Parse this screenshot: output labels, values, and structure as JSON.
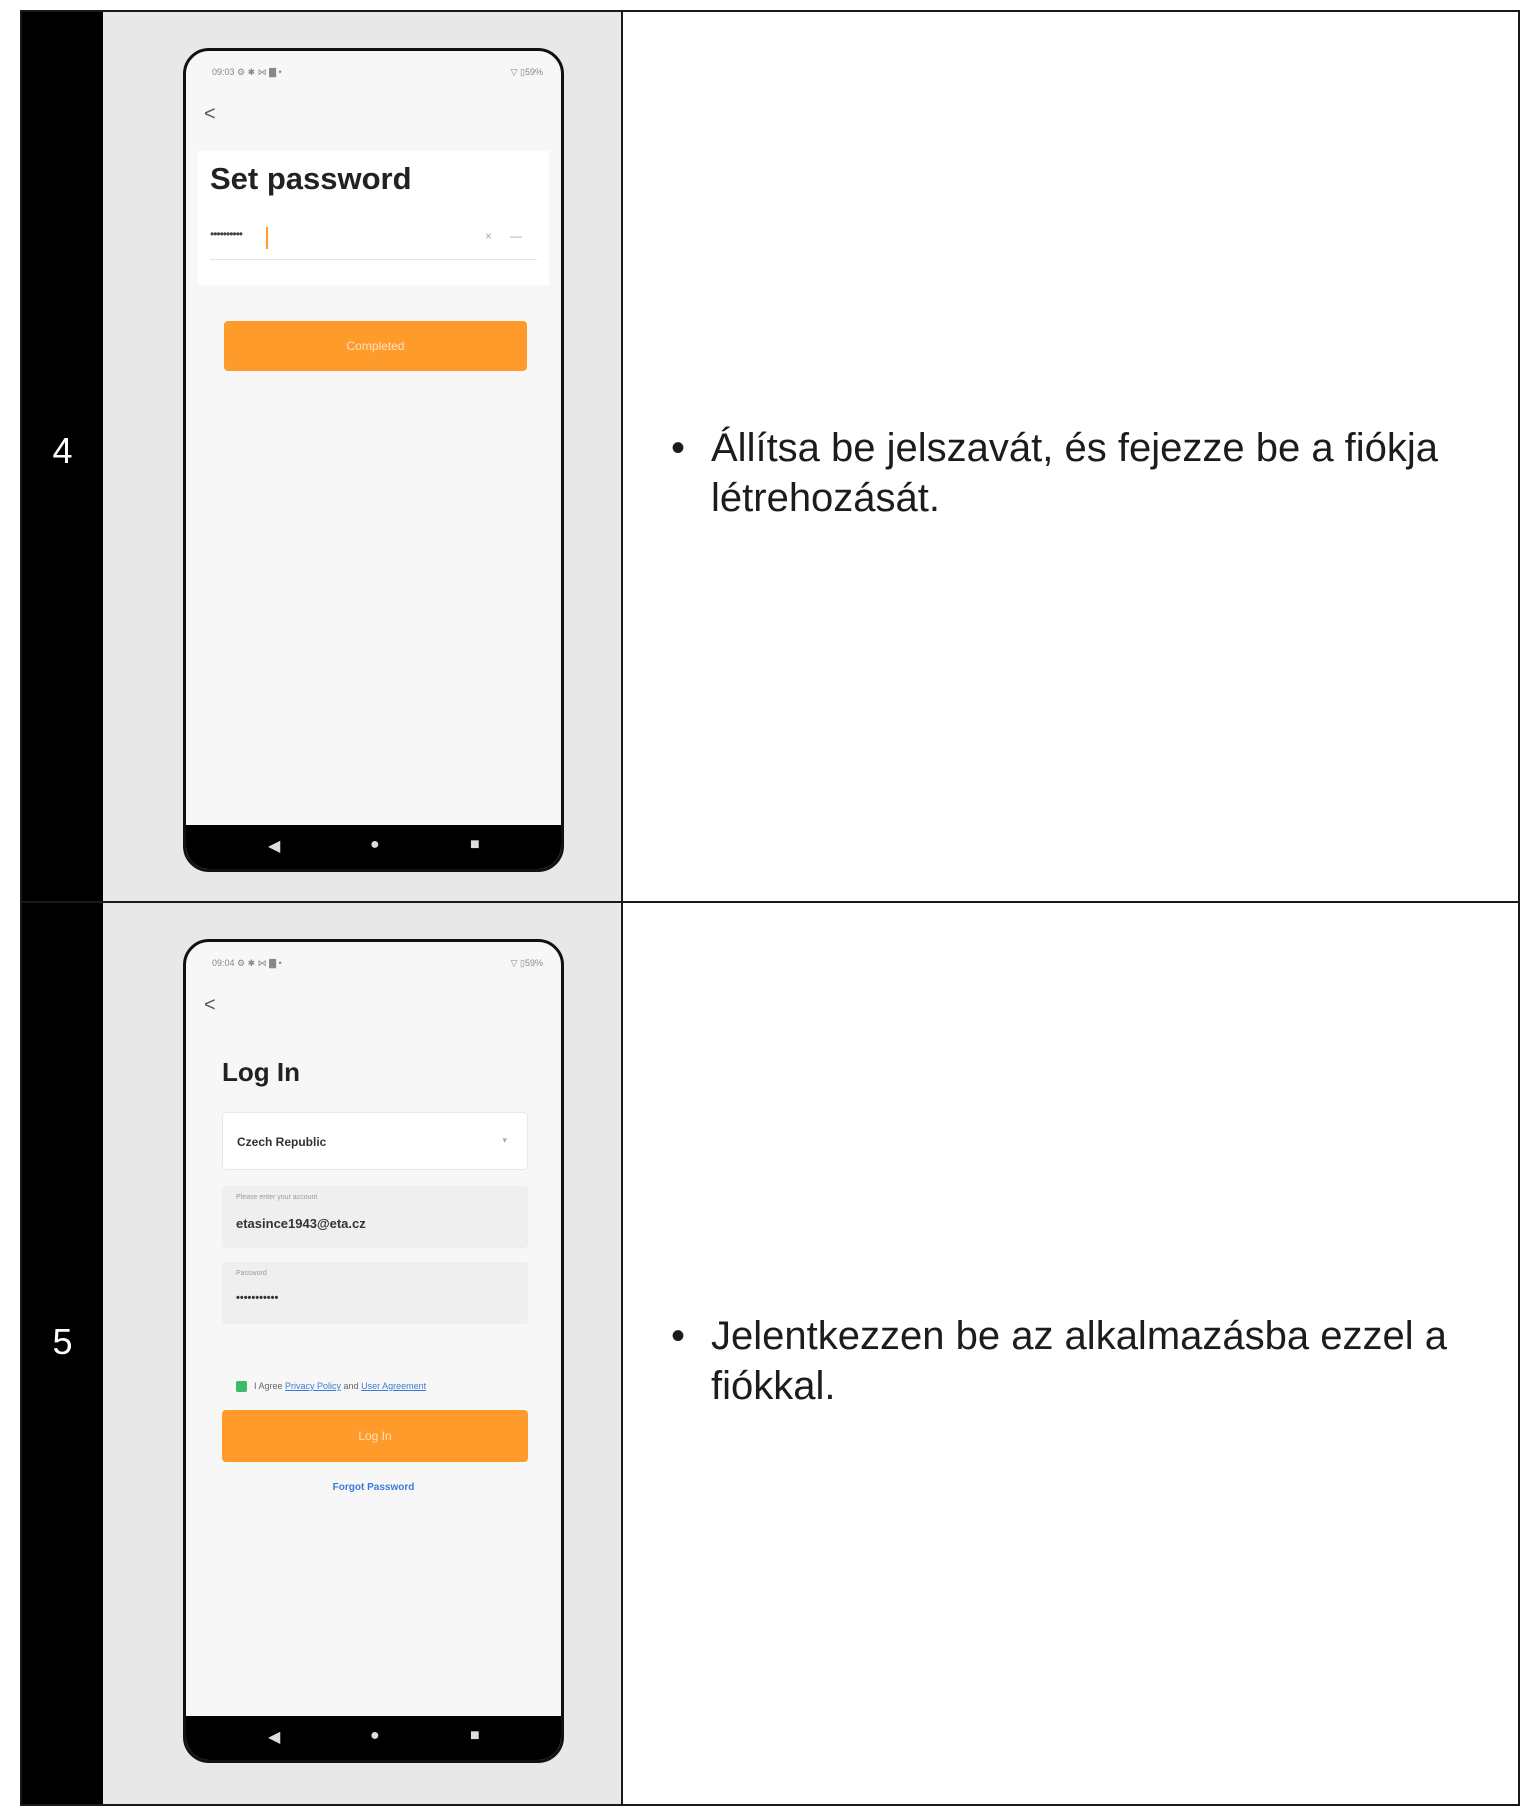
{
  "rows": [
    {
      "step": "4",
      "description": "Állítsa be jelszavát, és fejezze be a fiókja létrehozását.",
      "phone": {
        "status_left": "09:03 ⚙ ✱ ⋈ ▇ •",
        "status_right": "▽ ▯59%",
        "back": "<",
        "title": "Set password",
        "password_dots": "••••••••••",
        "clear_icon": "×",
        "eye_icon": "—",
        "button": "Completed"
      }
    },
    {
      "step": "5",
      "description": "Jelentkezzen be az alkalmazásba ezzel a fiókkal.",
      "phone": {
        "status_left": "09:04 ⚙ ✱ ⋈ ▇ •",
        "status_right": "▽ ▯59%",
        "back": "<",
        "title": "Log In",
        "country": "Czech Republic",
        "account_label": "Please enter your account",
        "account_value": "etasince1943@eta.cz",
        "password_label": "Password",
        "password_dots": "•••••••••••",
        "agree_prefix": "I Agree ",
        "privacy_link": "Privacy Policy",
        "agree_and": " and ",
        "user_agreement_link": "User Agreement",
        "button": "Log In",
        "forgot": "Forgot Password"
      }
    }
  ],
  "nav_icons": {
    "back": "◀",
    "home": "●",
    "recent": "■"
  },
  "bullet": "•",
  "colors": {
    "accent": "#ff9b2b",
    "link": "#3b7bd6",
    "checkbox": "#3dbb6b"
  }
}
